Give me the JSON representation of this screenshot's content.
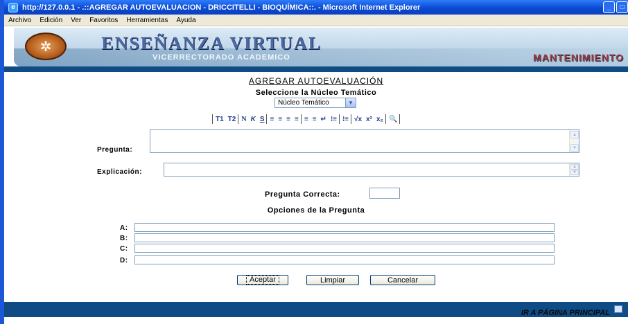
{
  "window": {
    "title": "http://127.0.0.1 - .::AGREGAR AUTOEVALUACION - DRICCITELLI - BIOQUÍMICA::. - Microsoft Internet Explorer"
  },
  "menu": [
    "Archivo",
    "Edición",
    "Ver",
    "Favoritos",
    "Herramientas",
    "Ayuda"
  ],
  "banner": {
    "title": "ENSEÑANZA VIRTUAL",
    "subtitle": "VICERRECTORADO ACADEMICO",
    "section": "MANTENIMIENTO"
  },
  "form": {
    "title": "AGREGAR AUTOEVALUACIÓN",
    "select_label": "Seleccione la Núcleo Temático",
    "select_value": "Núcleo Temático",
    "toolbar": [
      "T1",
      "T2",
      "N",
      "K",
      "S",
      "≡",
      "≡",
      "≡",
      "≡",
      "≡",
      "≡",
      "↵",
      "⁝≡",
      "⁝≡",
      "√x",
      "x²",
      "x₂",
      "🔍"
    ],
    "pregunta_label": "Pregunta:",
    "explicacion_label": "Explicación:",
    "correcta_label": "Pregunta Correcta:",
    "opciones_title": "Opciones de la Pregunta",
    "options": [
      {
        "label": "A:",
        "value": ""
      },
      {
        "label": "B:",
        "value": ""
      },
      {
        "label": "C:",
        "value": ""
      },
      {
        "label": "D:",
        "value": ""
      }
    ],
    "buttons": {
      "accept": "Aceptar",
      "clear": "Limpiar",
      "cancel": "Cancelar"
    }
  },
  "footer": {
    "link": "IR A PÁGINA PRINCIPAL"
  },
  "colors": {
    "brand_blue": "#0f4c86",
    "title_blue": "#0a4ad2"
  }
}
